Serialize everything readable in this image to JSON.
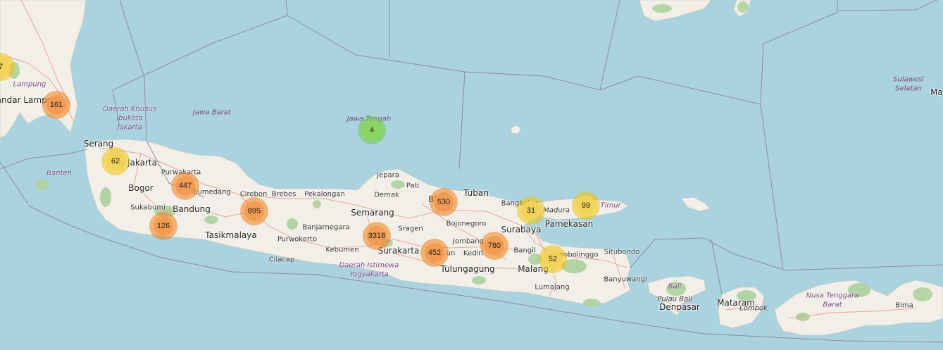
{
  "map": {
    "colors": {
      "water": "#aad3df",
      "land": "#f2efe9",
      "forest": "#add19e",
      "road": "#e89a8a",
      "boundary": "#8c8ca3",
      "cluster_large": "#f09b50",
      "cluster_medium": "#f1d357",
      "cluster_small": "#8cd45f"
    },
    "clusters": [
      {
        "count": "7",
        "tier": "medium"
      },
      {
        "count": "161",
        "tier": "large"
      },
      {
        "count": "4",
        "tier": "small"
      },
      {
        "count": "62",
        "tier": "medium"
      },
      {
        "count": "447",
        "tier": "large"
      },
      {
        "count": "895",
        "tier": "large"
      },
      {
        "count": "126",
        "tier": "large"
      },
      {
        "count": "3318",
        "tier": "large"
      },
      {
        "count": "530",
        "tier": "large"
      },
      {
        "count": "31",
        "tier": "medium"
      },
      {
        "count": "99",
        "tier": "medium"
      },
      {
        "count": "452",
        "tier": "large"
      },
      {
        "count": "780",
        "tier": "large"
      },
      {
        "count": "52",
        "tier": "medium"
      }
    ],
    "places": {
      "bandar_lampung": "Bandar Lampung",
      "serang": "Serang",
      "jakarta": "Jakarta",
      "bogor": "Bogor",
      "purwakarta": "Purwakarta",
      "sumedang": "Sumedang",
      "sukabumi": "Sukabumi",
      "bandung": "Bandung",
      "tasikmalaya": "Tasikmalaya",
      "cirebon": "Cirebon",
      "brebes": "Brebes",
      "pekalongan": "Pekalongan",
      "jepara": "Jepara",
      "pati": "Pati",
      "demak": "Demak",
      "semarang": "Semarang",
      "banjarnegara": "Banjarnegara",
      "purwokerto": "Purwokerto",
      "kebumen": "Kebumen",
      "cilacap": "Cilacap",
      "sragen": "Sragen",
      "surakarta": "Surakarta",
      "tuban": "Tuban",
      "bojonegoro": "Bojonegoro",
      "jombang": "Jombang",
      "kediri": "Kediri",
      "tulungagung": "Tulungagung",
      "bangkalan": "Bangkalan",
      "surabaya": "Surabaya",
      "pamekasan": "Pamekasan",
      "bangil": "Bangil",
      "malang": "Malang",
      "lumajang": "Lumajang",
      "probolinggo": "Probolinggo",
      "situbondo": "Situbondo",
      "banyuwangi": "Banyuwangi",
      "denpasar": "Denpasar",
      "pulau_bali": "Pulau Bali",
      "mataram": "Mataram",
      "lombok": "Lombok",
      "bima": "Bima",
      "madura": "Madura",
      "bl_fragment": "Bl",
      "bun_fragment": "un",
      "ma_fragment": "Ma"
    },
    "regions": {
      "lampung": "Lampung",
      "dki_1": "Daerah Khusus",
      "dki_2": "Ibukota",
      "dki_3": "Jakarta",
      "banten": "Banten",
      "jawa_barat": "Jawa Barat",
      "jawa_tengah": "Jawa Tengah",
      "diy_1": "Daerah Istimewa",
      "diy_2": "Yogyakarta",
      "jatim_fragment": "Timur",
      "bali": "Bali",
      "ntb_1": "Nusa Tenggara",
      "ntb_2": "Barat",
      "sulsel_1": "Sulawesi",
      "sulsel_2": "Selatan"
    }
  }
}
